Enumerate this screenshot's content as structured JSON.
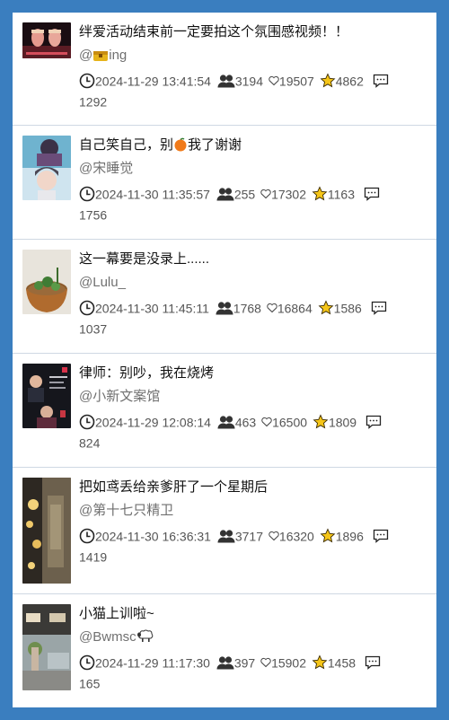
{
  "videos": [
    {
      "title": "绊爱活动结束前一定要拍这个氛围感视频！！",
      "author_prefix": "@",
      "author": "ing",
      "datetime": "2024-11-29 13:41:54",
      "viewers": "3194",
      "likes": "19507",
      "favorites": "4862",
      "comments": "1292"
    },
    {
      "title_a": "自己笑自己，别",
      "title_b": "我了谢谢",
      "author_prefix": "@",
      "author": "宋睡觉",
      "datetime": "2024-11-30 11:35:57",
      "viewers": "255",
      "likes": "17302",
      "favorites": "1163",
      "comments": "1756"
    },
    {
      "title": "这一幕要是没录上......",
      "author_prefix": "@",
      "author": "Lulu_",
      "datetime": "2024-11-30 11:45:11",
      "viewers": "1768",
      "likes": "16864",
      "favorites": "1586",
      "comments": "1037"
    },
    {
      "title": "律师：别吵，我在烧烤",
      "author_prefix": "@",
      "author": "小新文案馆",
      "datetime": "2024-11-29 12:08:14",
      "viewers": "463",
      "likes": "16500",
      "favorites": "1809",
      "comments": "824"
    },
    {
      "title": "把如鸢丢给亲爹肝了一个星期后",
      "author_prefix": "@",
      "author": "第十七只精卫",
      "datetime": "2024-11-30 16:36:31",
      "viewers": "3717",
      "likes": "16320",
      "favorites": "1896",
      "comments": "1419"
    },
    {
      "title": "小猫上训啦~",
      "author_prefix": "@",
      "author": "Bwmsc",
      "datetime": "2024-11-29 11:17:30",
      "viewers": "397",
      "likes": "15902",
      "favorites": "1458",
      "comments": "165"
    }
  ],
  "icons": {
    "datetime": "clock-icon",
    "viewers": "people-icon",
    "likes": "heart-icon",
    "favorites": "star-icon",
    "comments": "comment-icon"
  },
  "colors": {
    "background": "#3a7ebf",
    "star": "#f5c518"
  }
}
